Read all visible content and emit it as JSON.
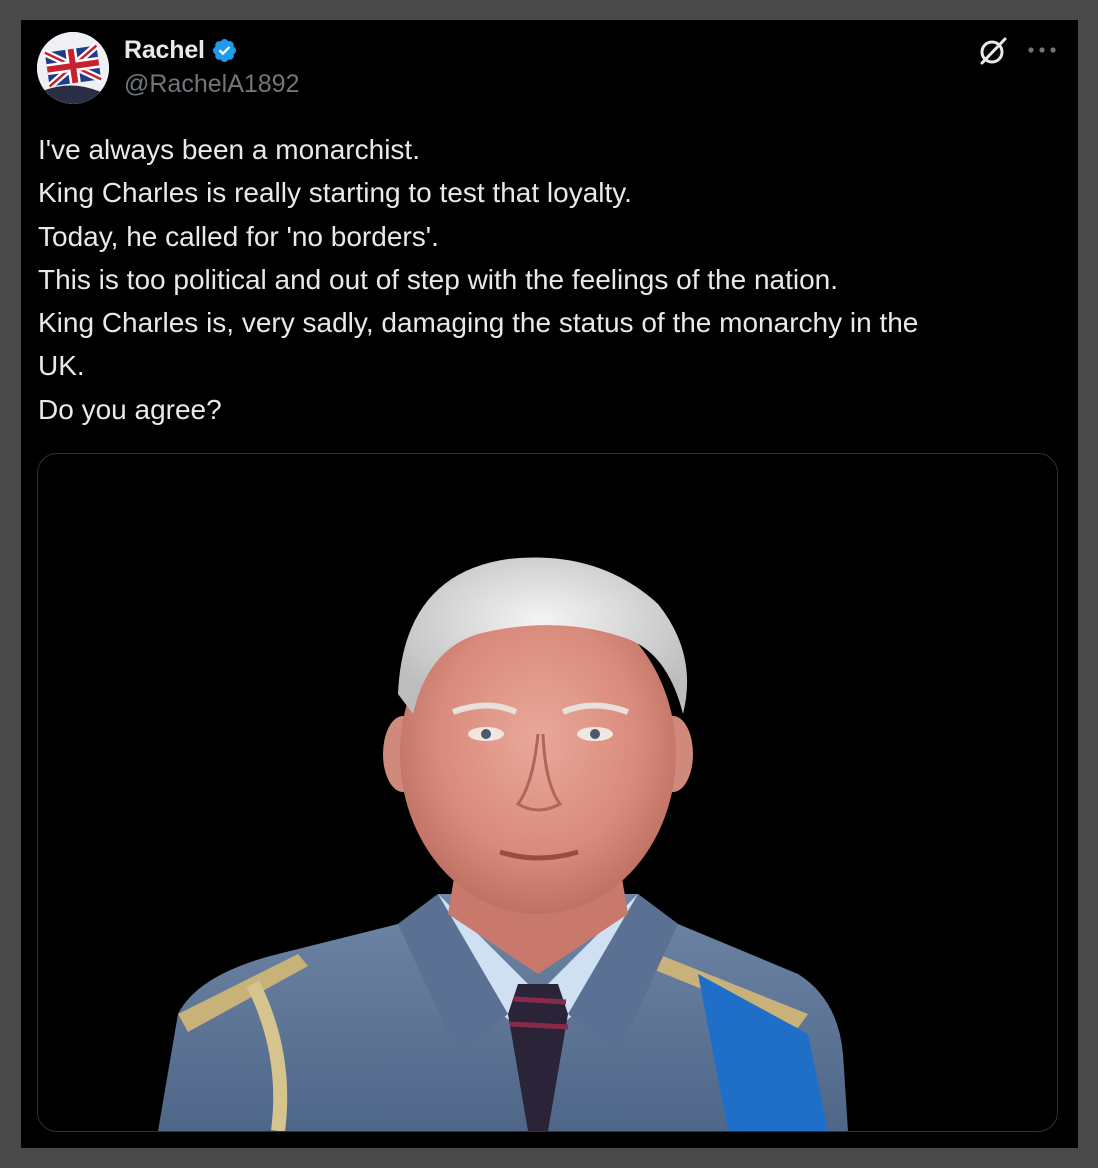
{
  "author": {
    "display_name": "Rachel",
    "handle": "@RachelA1892",
    "verified": true,
    "avatar_icon": "union-jack-icon"
  },
  "actions": {
    "grok_icon": "grok-icon",
    "more_icon": "more-horizontal-icon"
  },
  "tweet": {
    "lines": [
      "I've always been a monarchist.",
      "King Charles is really starting to test that loyalty.",
      "Today, he called for 'no borders'.",
      "This is too political and out of step with the feelings of the nation.",
      "King Charles is, very sadly, damaging the status of the monarchy in the",
      "UK.",
      "Do you agree?"
    ]
  },
  "media": {
    "description_icon": "portrait-photo"
  },
  "colors": {
    "background": "#000000",
    "text": "#e7e9ea",
    "secondary_text": "#71767b",
    "verified_blue": "#1d9bf0",
    "border": "#2f3336",
    "outer_frame": "#4a4a4a"
  }
}
